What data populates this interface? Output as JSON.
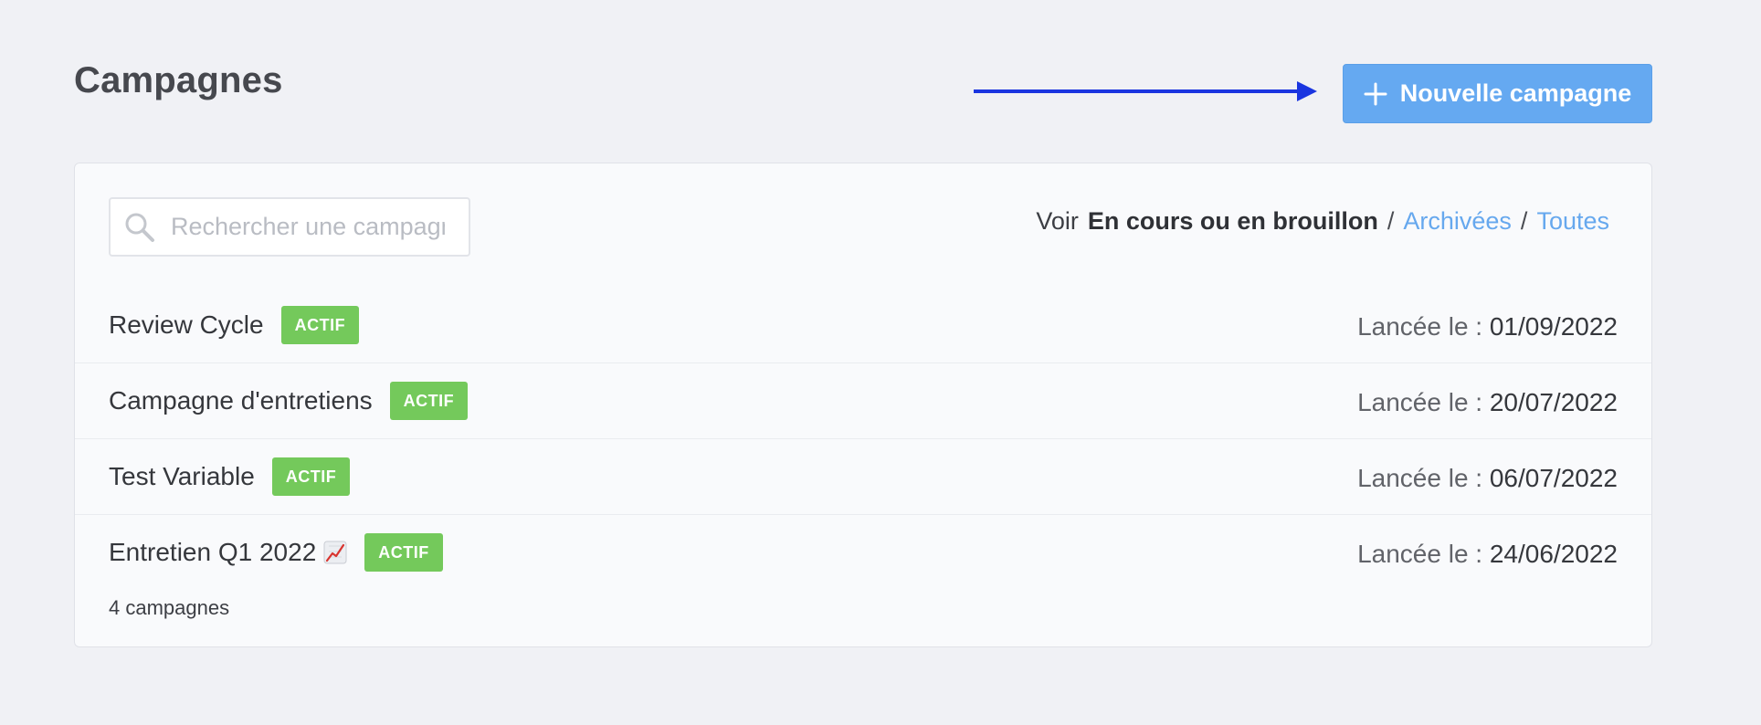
{
  "header": {
    "title": "Campagnes",
    "new_button_label": "Nouvelle campagne"
  },
  "search": {
    "placeholder": "Rechercher une campagne",
    "value": ""
  },
  "filters": {
    "prefix": "Voir",
    "current": "En cours ou en brouillon",
    "separator": "/",
    "archived": "Archivées",
    "all": "Toutes"
  },
  "campaigns": [
    {
      "name": "Review Cycle",
      "status": "ACTIF",
      "launched_label": "Lancée le :",
      "date": "01/09/2022"
    },
    {
      "name": "Campagne d'entretiens",
      "status": "ACTIF",
      "launched_label": "Lancée le :",
      "date": "20/07/2022"
    },
    {
      "name": "Test Variable",
      "status": "ACTIF",
      "launched_label": "Lancée le :",
      "date": "06/07/2022"
    },
    {
      "name": "Entretien Q1 2022",
      "status": "ACTIF",
      "launched_label": "Lancée le :",
      "date": "24/06/2022",
      "icon": "chart-increasing-icon"
    }
  ],
  "footer": {
    "count_text": "4 campagnes"
  },
  "colors": {
    "background": "#f0f1f5",
    "primary": "#65a9f1",
    "link": "#66a8ee",
    "active_badge": "#74c95b",
    "annotation_arrow": "#1a35e0"
  }
}
